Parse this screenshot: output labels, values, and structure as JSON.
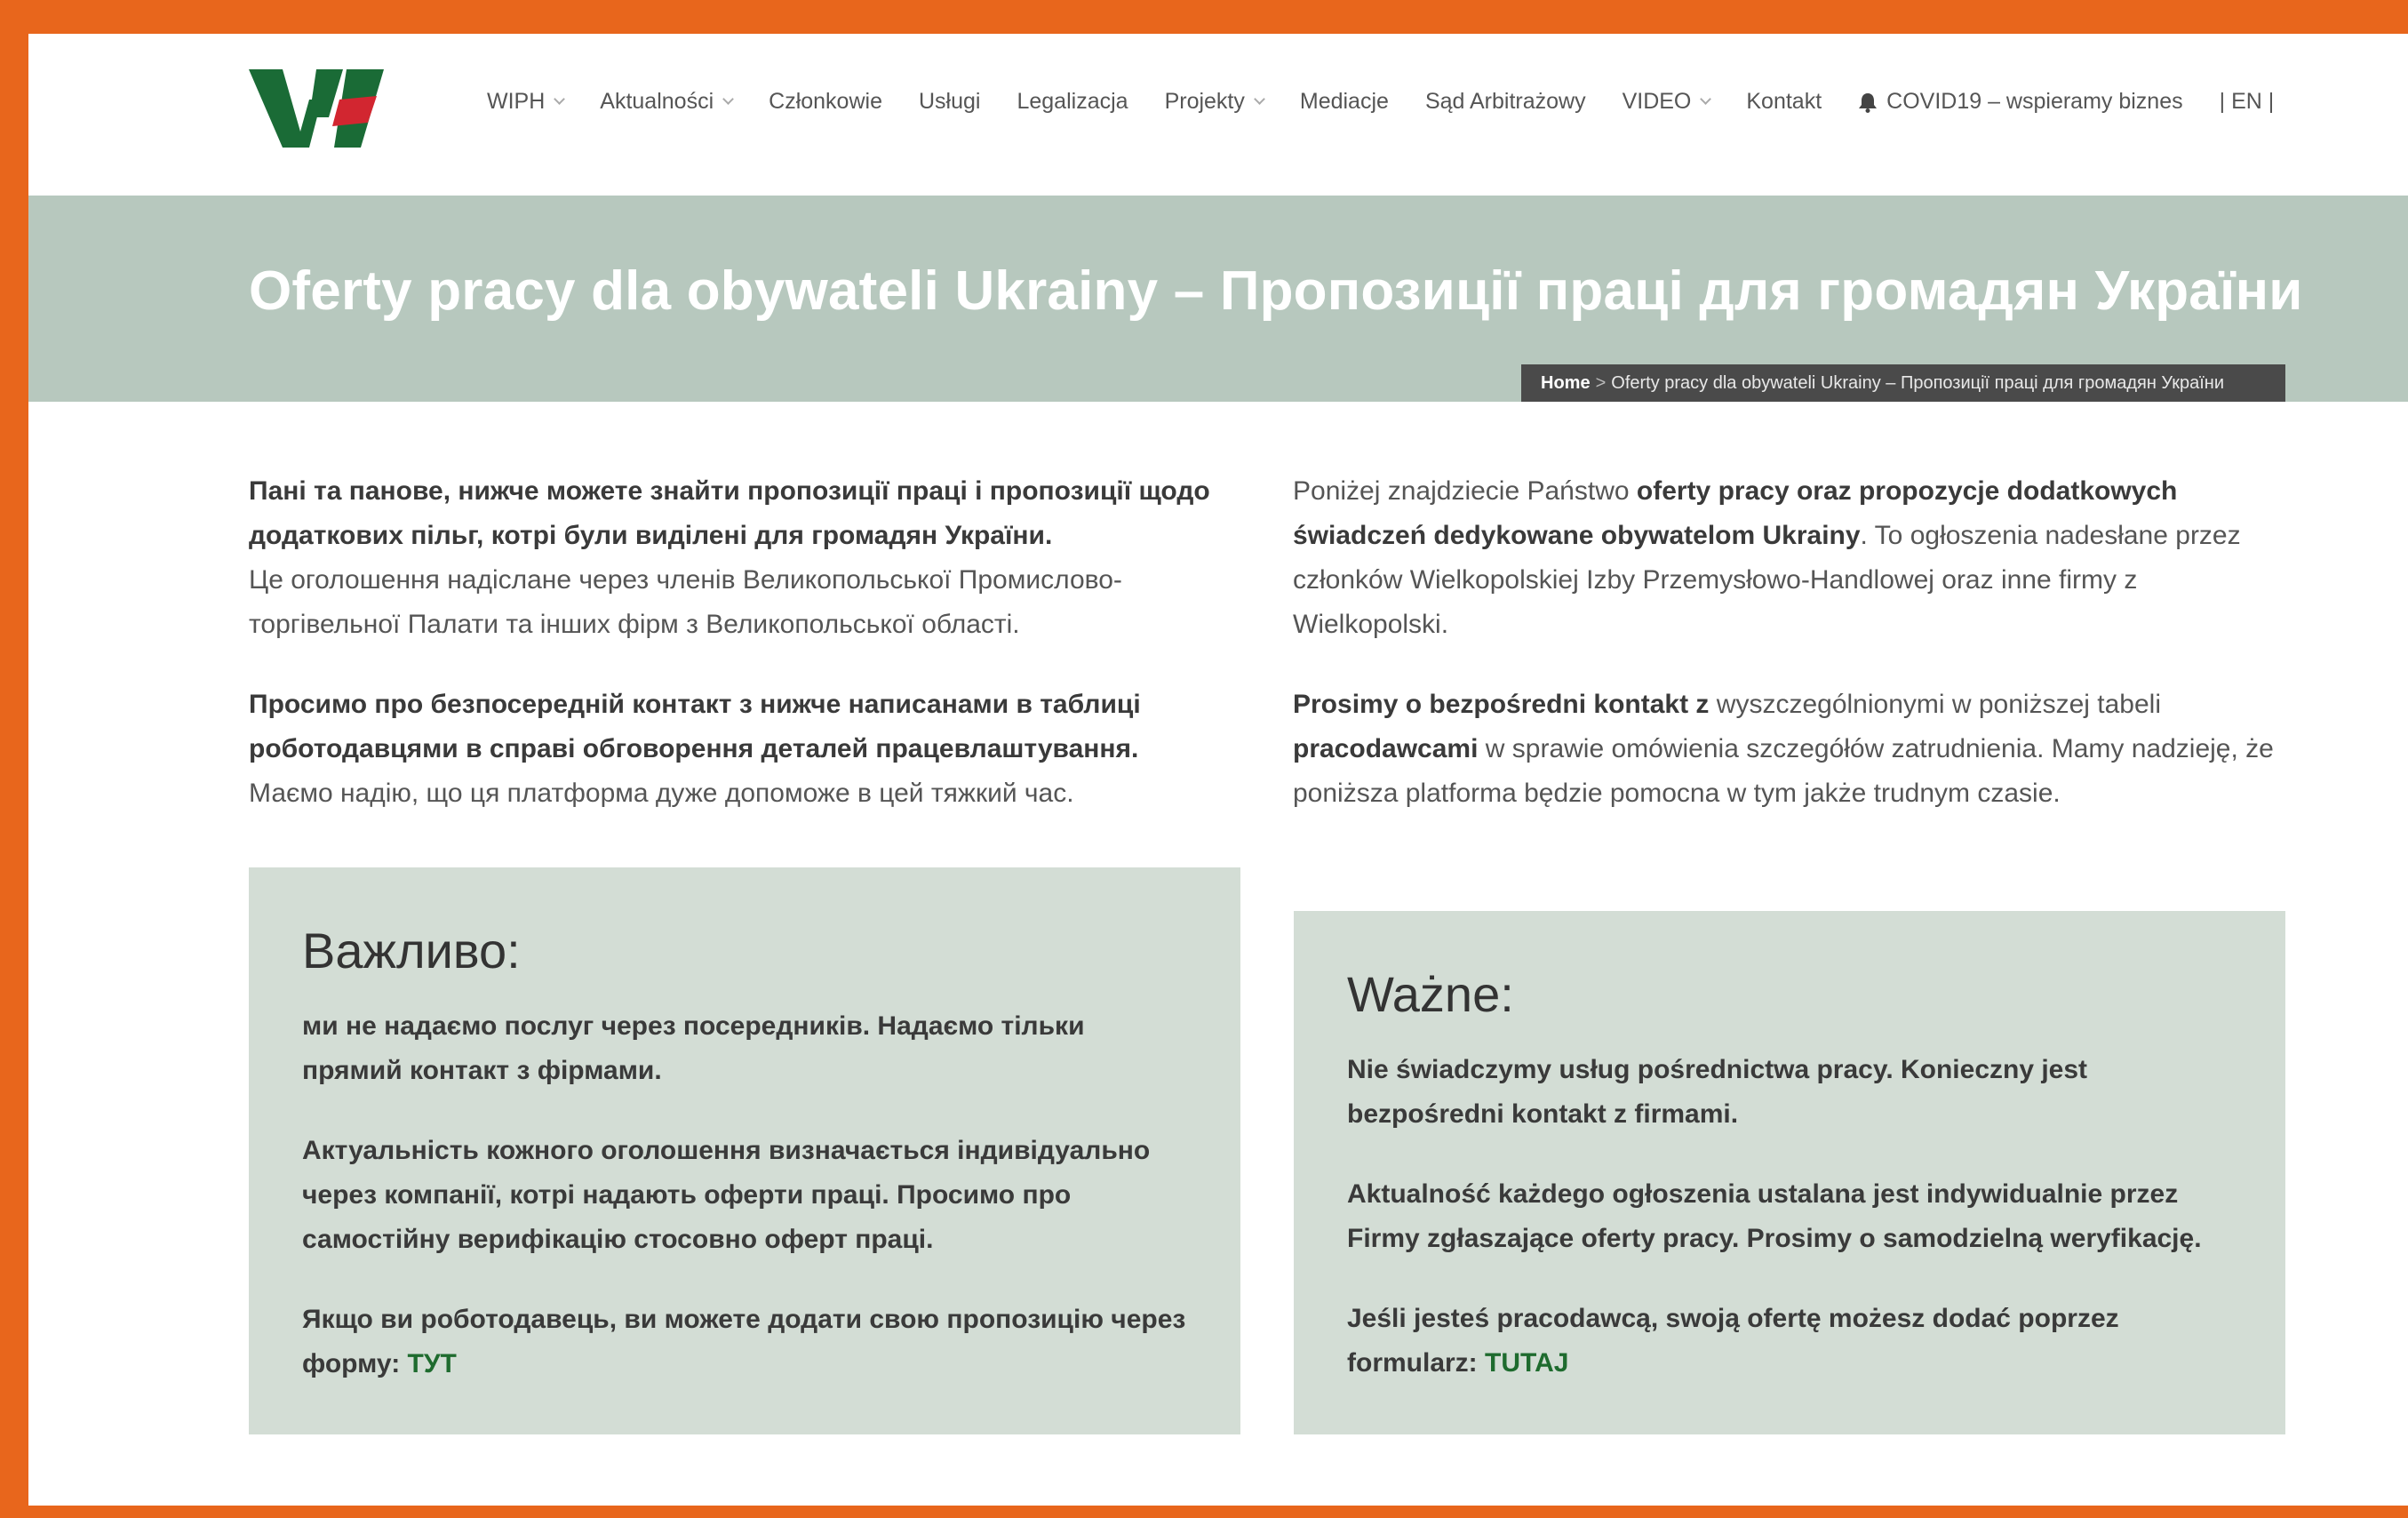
{
  "colors": {
    "frame": "#e8661c",
    "title_band": "#b7c8be",
    "box_bg": "#d3ddd5",
    "link": "#1e6b2e",
    "logo_green": "#1a6b36",
    "logo_red": "#d22630"
  },
  "header": {
    "logo_icon": "wiph-logo",
    "nav": [
      {
        "label": "WIPH",
        "dropdown": true
      },
      {
        "label": "Aktualności",
        "dropdown": true
      },
      {
        "label": "Członkowie",
        "dropdown": false
      },
      {
        "label": "Usługi",
        "dropdown": false
      },
      {
        "label": "Legalizacja",
        "dropdown": false
      },
      {
        "label": "Projekty",
        "dropdown": true
      },
      {
        "label": "Mediacje",
        "dropdown": false
      },
      {
        "label": "Sąd Arbitrażowy",
        "dropdown": false
      },
      {
        "label": "VIDEO",
        "dropdown": true
      },
      {
        "label": "Kontakt",
        "dropdown": false
      },
      {
        "label": "COVID19 – wspieramy biznes",
        "icon": "bell-icon"
      },
      {
        "label": "| EN |"
      }
    ]
  },
  "page": {
    "title": "Oferty pracy dla obywateli Ukrainy – Пропозиції праці для громадян України",
    "breadcrumb": {
      "home": "Home",
      "separator": ">",
      "current": "Oferty pracy dla obywateli Ukrainy – Пропозиції праці для громадян України"
    }
  },
  "left": {
    "p1_bold": "Пані та панове, нижче можете знайти пропозиції праці і пропозиції щодо додаткових пільг, котрі були виділені для громадян України.",
    "p1_text": "Це оголошення надіслане через членів Великопольської Промислово-торгівельної Палати та інших фірм з Великопольської області.",
    "p2_bold": "Просимо про безпосередній контакт з нижче написанами в таблиці роботодавцями в справі обговорення деталей працевлаштування.",
    "p2_text": "Маємо надію, що ця платформа дуже допоможе в цей тяжкий час.",
    "box": {
      "title": "Важливо:",
      "p1": "ми не надаємо послуг через посередників. Надаємо тільки прямий контакт з фірмами.",
      "p2": "Актуальність кожного оголошення визначається індивідуально через компанії, котрі надають оферти праці. Просимо про самостійну верифікацію стосовно оферт праці.",
      "p3": "Якщо ви роботодавець, ви можете додати свою пропозицію через форму:",
      "link": "ТУТ"
    }
  },
  "right": {
    "p1_a": "Poniżej znajdziecie Państwo",
    "p1_bold": "oferty pracy oraz propozycje dodatkowych świadczeń dedykowane obywatelom Ukrainy",
    "p1_b": ". To ogłoszenia nadesłane przez członków Wielkopolskiej Izby Przemysłowo-Handlowej oraz inne firmy z Wielkopolski.",
    "p2_bold1": "Prosimy o bezpośredni kontakt z",
    "p2_a": "wyszczególnionymi w poniższej tabeli",
    "p2_bold2": "pracodawcami",
    "p2_b": "w sprawie omówienia szczegółów zatrudnienia. Mamy nadzieję, że poniższa platforma będzie pomocna w tym jakże trudnym czasie.",
    "box": {
      "title": "Ważne:",
      "p1": "Nie świadczymy usług pośrednictwa pracy. Konieczny jest bezpośredni kontakt z firmami.",
      "p2": "Aktualność każdego ogłoszenia ustalana jest indywidualnie przez Firmy zgłaszające oferty pracy. Prosimy o samodzielną weryfikację.",
      "p3": "Jeśli jesteś pracodawcą, swoją ofertę możesz dodać poprzez formularz:",
      "link": "TUTAJ"
    }
  }
}
